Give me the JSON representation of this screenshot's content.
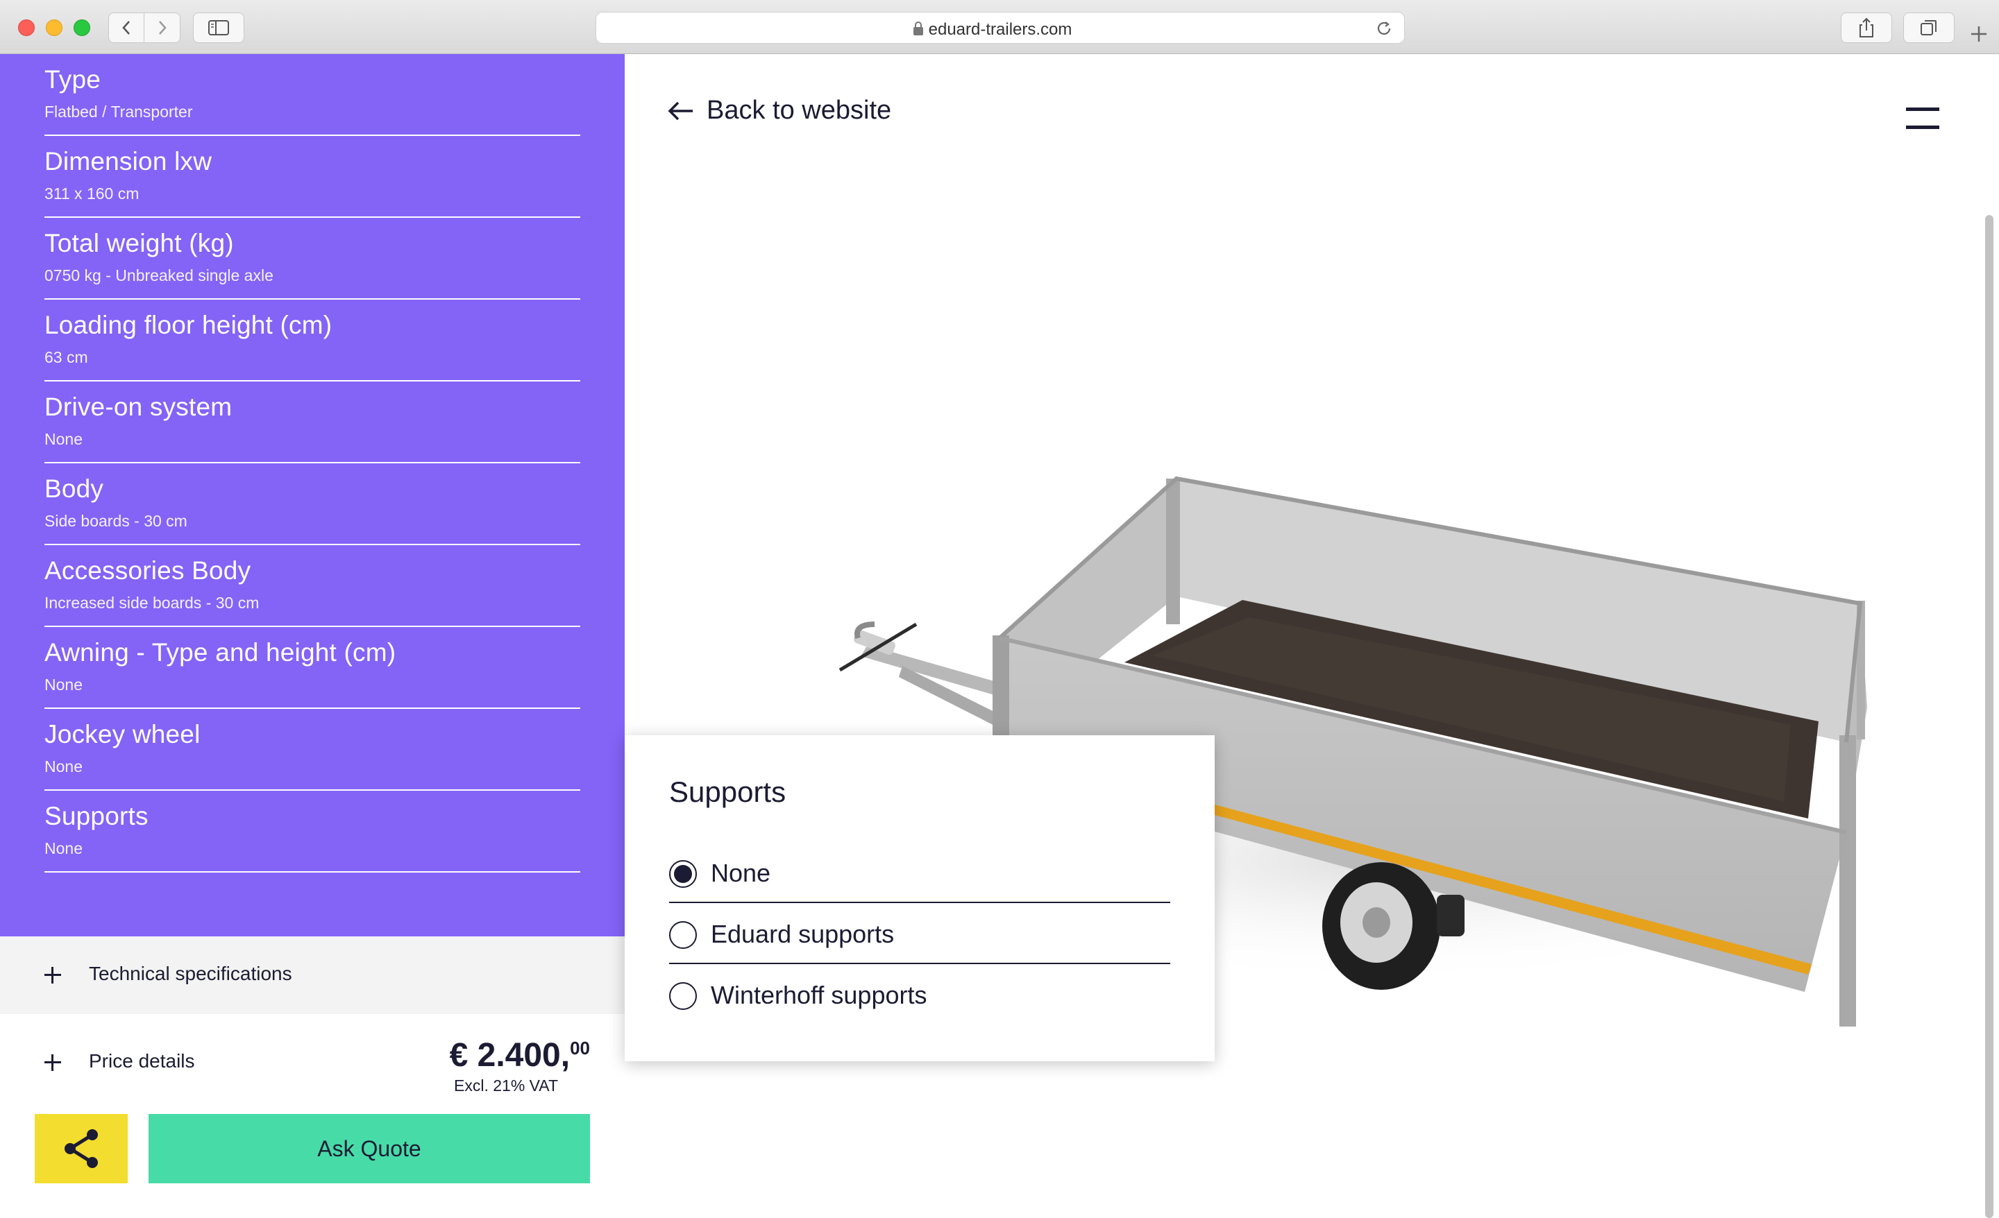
{
  "browser": {
    "url": "eduard-trailers.com"
  },
  "specs": [
    {
      "label": "Type",
      "value": "Flatbed / Transporter"
    },
    {
      "label": "Dimension lxw",
      "value": "311 x 160 cm"
    },
    {
      "label": "Total weight (kg)",
      "value": "0750 kg - Unbreaked single axle"
    },
    {
      "label": "Loading floor height (cm)",
      "value": "63 cm"
    },
    {
      "label": "Drive-on system",
      "value": "None"
    },
    {
      "label": "Body",
      "value": "Side boards - 30 cm"
    },
    {
      "label": "Accessories Body",
      "value": "Increased side boards - 30 cm"
    },
    {
      "label": "Awning - Type and height (cm)",
      "value": "None"
    },
    {
      "label": "Jockey wheel",
      "value": "None"
    },
    {
      "label": "Supports",
      "value": "None"
    }
  ],
  "technical": {
    "label": "Technical specifications"
  },
  "price": {
    "label": "Price details",
    "amount": "€ 2.400,",
    "cents": "00",
    "vat": "Excl. 21% VAT"
  },
  "actions": {
    "quote_label": "Ask Quote"
  },
  "viewer": {
    "back_label": "Back to website"
  },
  "popup": {
    "title": "Supports",
    "options": [
      {
        "label": "None",
        "selected": true
      },
      {
        "label": "Eduard supports",
        "selected": false
      },
      {
        "label": "Winterhoff supports",
        "selected": false
      }
    ]
  },
  "colors": {
    "panel": "#8463f7",
    "share_button": "#f3dd2e",
    "quote_button": "#47dba8",
    "text_dark": "#1b1b33"
  }
}
